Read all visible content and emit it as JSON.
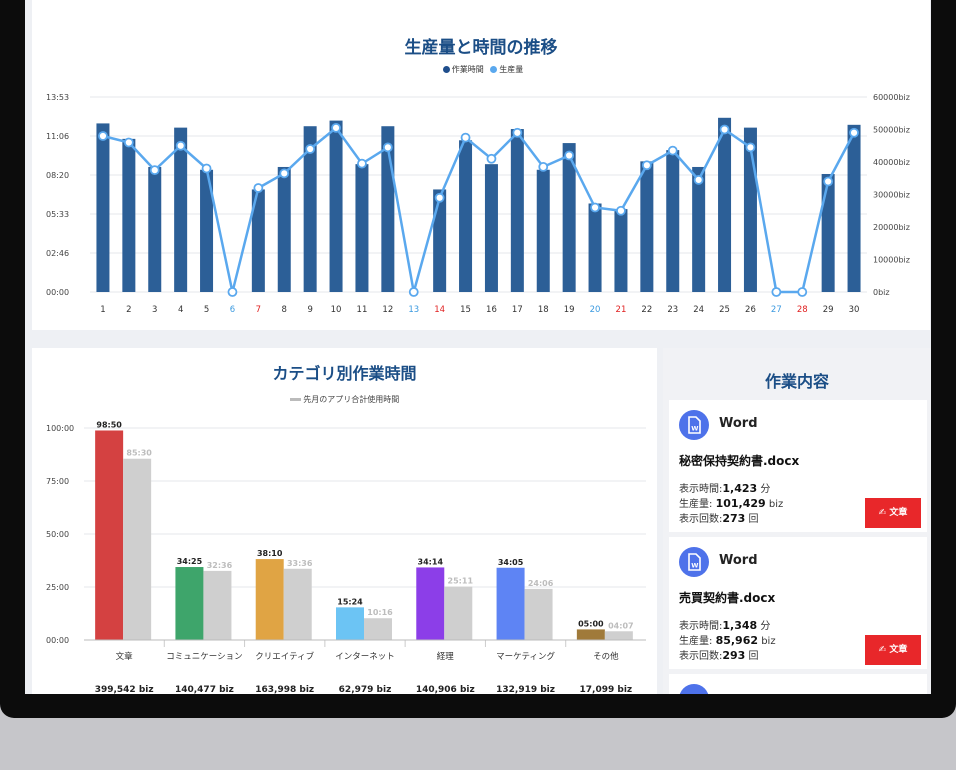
{
  "production_chart": {
    "title": "生産量と時間の推移",
    "legend": [
      {
        "label": "作業時間",
        "color": "#1f4e8c"
      },
      {
        "label": "生産量",
        "color": "#5aa8ee"
      }
    ],
    "left_ticks": [
      "13:53",
      "11:06",
      "08:20",
      "05:33",
      "02:46",
      "00:00"
    ],
    "right_ticks": [
      "60000biz",
      "50000biz",
      "40000biz",
      "30000biz",
      "20000biz",
      "10000biz",
      "0biz"
    ],
    "day_labels": [
      {
        "text": "1",
        "color": "#333"
      },
      {
        "text": "2",
        "color": "#333"
      },
      {
        "text": "3",
        "color": "#333"
      },
      {
        "text": "4",
        "color": "#333"
      },
      {
        "text": "5",
        "color": "#333"
      },
      {
        "text": "6",
        "color": "#3b9ae0"
      },
      {
        "text": "7",
        "color": "#e02020"
      },
      {
        "text": "8",
        "color": "#333"
      },
      {
        "text": "9",
        "color": "#333"
      },
      {
        "text": "10",
        "color": "#333"
      },
      {
        "text": "11",
        "color": "#333"
      },
      {
        "text": "12",
        "color": "#333"
      },
      {
        "text": "13",
        "color": "#3b9ae0"
      },
      {
        "text": "14",
        "color": "#e02020"
      },
      {
        "text": "15",
        "color": "#333"
      },
      {
        "text": "16",
        "color": "#333"
      },
      {
        "text": "17",
        "color": "#333"
      },
      {
        "text": "18",
        "color": "#333"
      },
      {
        "text": "19",
        "color": "#333"
      },
      {
        "text": "20",
        "color": "#3b9ae0"
      },
      {
        "text": "21",
        "color": "#e02020"
      },
      {
        "text": "22",
        "color": "#333"
      },
      {
        "text": "23",
        "color": "#333"
      },
      {
        "text": "24",
        "color": "#333"
      },
      {
        "text": "25",
        "color": "#333"
      },
      {
        "text": "26",
        "color": "#333"
      },
      {
        "text": "27",
        "color": "#3b9ae0"
      },
      {
        "text": "28",
        "color": "#e02020"
      },
      {
        "text": "29",
        "color": "#333"
      },
      {
        "text": "30",
        "color": "#333"
      }
    ]
  },
  "category_chart": {
    "title": "カテゴリ別作業時間",
    "legend_label": "先月のアプリ合計使用時間",
    "y_ticks": [
      "100:00",
      "75:00",
      "50:00",
      "25:00",
      "00:00"
    ],
    "categories": [
      {
        "name": "文章",
        "current_label": "98:50",
        "previous_label": "85:30",
        "color": "#d44141",
        "biz": "399,542 biz"
      },
      {
        "name": "コミュニケーション",
        "current_label": "34:25",
        "previous_label": "32:36",
        "color": "#3ea56b",
        "biz": "140,477 biz"
      },
      {
        "name": "クリエイティブ",
        "current_label": "38:10",
        "previous_label": "33:36",
        "color": "#e0a444",
        "biz": "163,998 biz"
      },
      {
        "name": "インターネット",
        "current_label": "15:24",
        "previous_label": "10:16",
        "color": "#6cc4f4",
        "biz": "62,979 biz"
      },
      {
        "name": "経理",
        "current_label": "34:14",
        "previous_label": "25:11",
        "color": "#8c3ee8",
        "biz": "140,906 biz"
      },
      {
        "name": "マーケティング",
        "current_label": "34:05",
        "previous_label": "24:06",
        "color": "#5e84f4",
        "biz": "132,919 biz"
      },
      {
        "name": "その他",
        "current_label": "05:00",
        "previous_label": "04:07",
        "color": "#a07a3a",
        "biz": "17,099 biz"
      }
    ]
  },
  "chart_data": [
    {
      "type": "bar",
      "title": "生産量と時間の推移",
      "x": [
        1,
        2,
        3,
        4,
        5,
        6,
        7,
        8,
        9,
        10,
        11,
        12,
        13,
        14,
        15,
        16,
        17,
        18,
        19,
        20,
        21,
        22,
        23,
        24,
        25,
        26,
        27,
        28,
        29,
        30
      ],
      "ylim_left_hours": [
        0,
        13.88
      ],
      "ylim_right_biz": [
        0,
        60000
      ],
      "series": [
        {
          "name": "作業時間",
          "axis": "left",
          "unit": "hours",
          "values": [
            12.0,
            10.9,
            8.9,
            11.7,
            8.7,
            0,
            7.3,
            8.9,
            11.8,
            12.2,
            9.1,
            11.8,
            0,
            7.3,
            10.8,
            9.1,
            11.6,
            8.7,
            10.6,
            6.3,
            5.9,
            9.3,
            10.1,
            8.9,
            12.4,
            11.7,
            0,
            0,
            8.4,
            11.9
          ]
        },
        {
          "name": "生産量",
          "axis": "right",
          "unit": "biz",
          "type": "line",
          "values": [
            48000,
            46000,
            37500,
            45000,
            38000,
            0,
            32000,
            36500,
            44000,
            50500,
            39500,
            44500,
            0,
            29000,
            47500,
            41000,
            49000,
            38500,
            42000,
            26000,
            25000,
            39000,
            43500,
            34500,
            50000,
            44500,
            0,
            0,
            34000,
            49000
          ]
        }
      ]
    },
    {
      "type": "bar",
      "title": "カテゴリ別作業時間",
      "categories": [
        "文章",
        "コミュニケーション",
        "クリエイティブ",
        "インターネット",
        "経理",
        "マーケティング",
        "その他"
      ],
      "ylim_hours": [
        0,
        100
      ],
      "series": [
        {
          "name": "当月",
          "values": [
            98.83,
            34.42,
            38.17,
            15.4,
            34.23,
            34.08,
            5.0
          ]
        },
        {
          "name": "先月のアプリ合計使用時間",
          "values": [
            85.5,
            32.6,
            33.6,
            10.27,
            25.18,
            24.1,
            4.12
          ]
        }
      ]
    }
  ],
  "work_content": {
    "title": "作業内容",
    "items": [
      {
        "app": "Word",
        "file": "秘密保持契約書.docx",
        "time_label": "表示時間:",
        "time_value": "1,423",
        "time_unit": " 分",
        "prod_label": "生産量: ",
        "prod_value": "101,429",
        "prod_unit": " biz",
        "count_label": "表示回数:",
        "count_value": "273",
        "count_unit": " 回",
        "badge": "文章",
        "badge_icon": "pen-icon",
        "app_icon": "word-document-icon"
      },
      {
        "app": "Word",
        "file": "売買契約書.docx",
        "time_label": "表示時間:",
        "time_value": "1,348",
        "time_unit": " 分",
        "prod_label": "生産量: ",
        "prod_value": "85,962",
        "prod_unit": " biz",
        "count_label": "表示回数:",
        "count_value": "293",
        "count_unit": " 回",
        "badge": "文章",
        "badge_icon": "pen-icon",
        "app_icon": "word-document-icon"
      }
    ]
  }
}
